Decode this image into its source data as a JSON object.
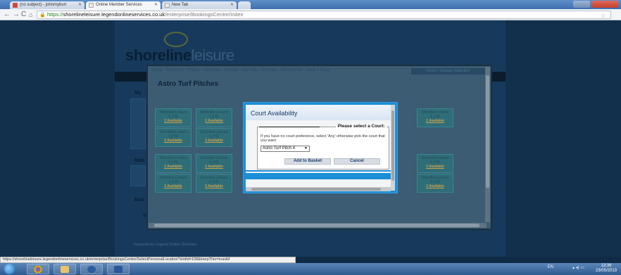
{
  "browser": {
    "tabs": [
      {
        "label": "(no subject) - johnmyburr",
        "favicon_color": "#d14836"
      },
      {
        "label": "Online Member Services",
        "favicon_color": "#e8e8e8"
      },
      {
        "label": "New Tab",
        "favicon_color": "#e8e8e8"
      }
    ],
    "url_scheme": "https://",
    "url_host": "shorelineleisure.legendonlineservices.co.uk",
    "url_path": "/enterprise/BookingsCentre/Index"
  },
  "site": {
    "logo_dark": "shoreline",
    "logo_light": "leisure",
    "days_nav": "Today · Tomorrow · Friday · Saturday · Sunday · Monday · Tuesday · Wednesday · Next 7 Days",
    "left_labels": [
      "My",
      "Man",
      "Boo"
    ],
    "view_amend": "View / Amend My Bookings",
    "close_timetable": "Close Timetable",
    "powered_by": "Powered by Legend Online Services"
  },
  "timetable": {
    "title": "Astro Turf Pitches",
    "close_change": "Close / Change Selection",
    "slot_text": "Shoreline Leisure",
    "slot_sub": "1 x 55",
    "slot_link": "2 Available"
  },
  "modal": {
    "title": "Court Availability",
    "legend": "Please select a Court:",
    "hint": "If you have no court preference, select 'Any' otherwise pick the court that you want",
    "select_value": "Astro Turf Pitch 4",
    "add_button": "Add to Basket",
    "cancel_button": "Cancel"
  },
  "status_url": "https://shorelineleisure.legendonlineservices.co.uk/enterprise/BookingsCentre/SelectPersonalLocation?slotId=108&keepThis=true&if",
  "taskbar": {
    "tray_lang": "EN",
    "time": "13:36",
    "date": "23/05/2013"
  }
}
